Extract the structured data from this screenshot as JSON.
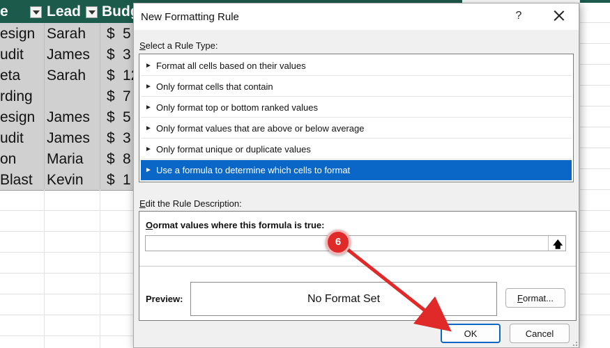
{
  "spreadsheet": {
    "headers": [
      {
        "label": "e"
      },
      {
        "label": "Lead"
      },
      {
        "label": "Budg"
      }
    ],
    "rows": [
      {
        "name": "esign",
        "lead": "Sarah",
        "cur": "$",
        "amt": "5"
      },
      {
        "name": "udit",
        "lead": "James",
        "cur": "$",
        "amt": "3"
      },
      {
        "name": "eta",
        "lead": "Sarah",
        "cur": "$",
        "amt": "12"
      },
      {
        "name": "rding",
        "lead": "",
        "cur": "$",
        "amt": "7"
      },
      {
        "name": "esign",
        "lead": "James",
        "cur": "$",
        "amt": "5"
      },
      {
        "name": "udit",
        "lead": "James",
        "cur": "$",
        "amt": "3"
      },
      {
        "name": "on",
        "lead": "Maria",
        "cur": "$",
        "amt": "8"
      },
      {
        "name": "Blast",
        "lead": "Kevin",
        "cur": "$",
        "amt": "1"
      }
    ]
  },
  "dialog": {
    "title": "New Formatting Rule",
    "help_glyph": "?",
    "select_rule_type_label": "Select a Rule Type:",
    "select_rule_type_accel": "S",
    "rule_types": [
      {
        "label": "Format all cells based on their values",
        "selected": false
      },
      {
        "label": "Only format cells that contain",
        "selected": false
      },
      {
        "label": "Only format top or bottom ranked values",
        "selected": false
      },
      {
        "label": "Only format values that are above or below average",
        "selected": false
      },
      {
        "label": "Only format unique or duplicate values",
        "selected": false
      },
      {
        "label": "Use a formula to determine which cells to format",
        "selected": true
      }
    ],
    "rule_arrow_glyph": "►",
    "edit_description_label": "Edit the Rule Description:",
    "edit_description_accel": "E",
    "formula_label": "Format values where this formula is true:",
    "formula_accel": "O",
    "formula_value": "",
    "collapse_glyph": "🡅",
    "preview_label": "Preview:",
    "preview_text": "No Format Set",
    "format_button": "Format...",
    "ok_button": "OK",
    "cancel_button": "Cancel"
  },
  "annotation": {
    "step_number": "6",
    "color": "#e02a2a"
  },
  "colors": {
    "table_header": "#1c5a4c",
    "selection": "#0a67c8",
    "dialog_bg": "#f0f0f0"
  }
}
